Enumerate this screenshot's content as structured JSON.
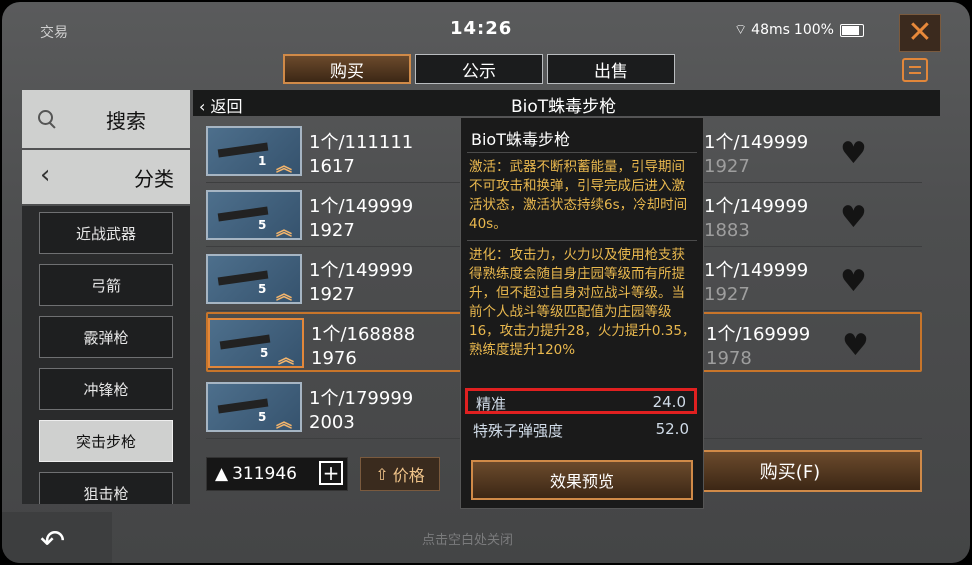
{
  "topbar": {
    "app_title": "交易",
    "time": "14:26",
    "ping": "48ms",
    "battery": "100%"
  },
  "tabs": [
    "购买",
    "公示",
    "出售"
  ],
  "sidebar": {
    "search_label": "搜索",
    "category_label": "分类",
    "categories": [
      "近战武器",
      "弓箭",
      "霰弹枪",
      "冲锋枪",
      "突击步枪",
      "狙击枪"
    ]
  },
  "header": {
    "back_label": "返回",
    "item_name": "BioT蛛毒步枪"
  },
  "listings": [
    {
      "level": "1",
      "price": "1个/111111",
      "sold": "1617",
      "price2": "1个/149999",
      "sold2": "1927"
    },
    {
      "level": "5",
      "price": "1个/149999",
      "sold": "1927",
      "price2": "1个/149999",
      "sold2": "1883"
    },
    {
      "level": "5",
      "price": "1个/149999",
      "sold": "1927",
      "price2": "1个/149999",
      "sold2": "1927"
    },
    {
      "level": "5",
      "price": "1个/168888",
      "sold": "1976",
      "price2": "1个/169999",
      "sold2": "1978"
    },
    {
      "level": "5",
      "price": "1个/179999",
      "sold": "2003"
    }
  ],
  "bottom": {
    "balance": "311946",
    "price_sort_label": "价格",
    "buy_label": "购买(F)",
    "close_hint": "点击空白处关闭"
  },
  "tooltip": {
    "title": "BioT蛛毒步枪",
    "activation": "激活：武器不断积蓄能量，引导期间不可攻击和换弹，引导完成后进入激活状态，激活状态持续6s，冷却时间40s。",
    "evolution": "进化：攻击力，火力以及使用枪支获得熟练度会随自身庄园等级而有所提升，但不超过自身对应战斗等级。当前个人战斗等级匹配值为庄园等级16，攻击力提升28，火力提升0.35，熟练度提升120%",
    "stats": [
      {
        "name": "精准",
        "value": "24.0"
      },
      {
        "name": "特殊子弹强度",
        "value": "52.0"
      }
    ],
    "effect_button": "效果预览"
  },
  "colors": {
    "accent": "#d08a48",
    "highlight": "#e02020",
    "tooltip_text": "#e9b84e"
  }
}
